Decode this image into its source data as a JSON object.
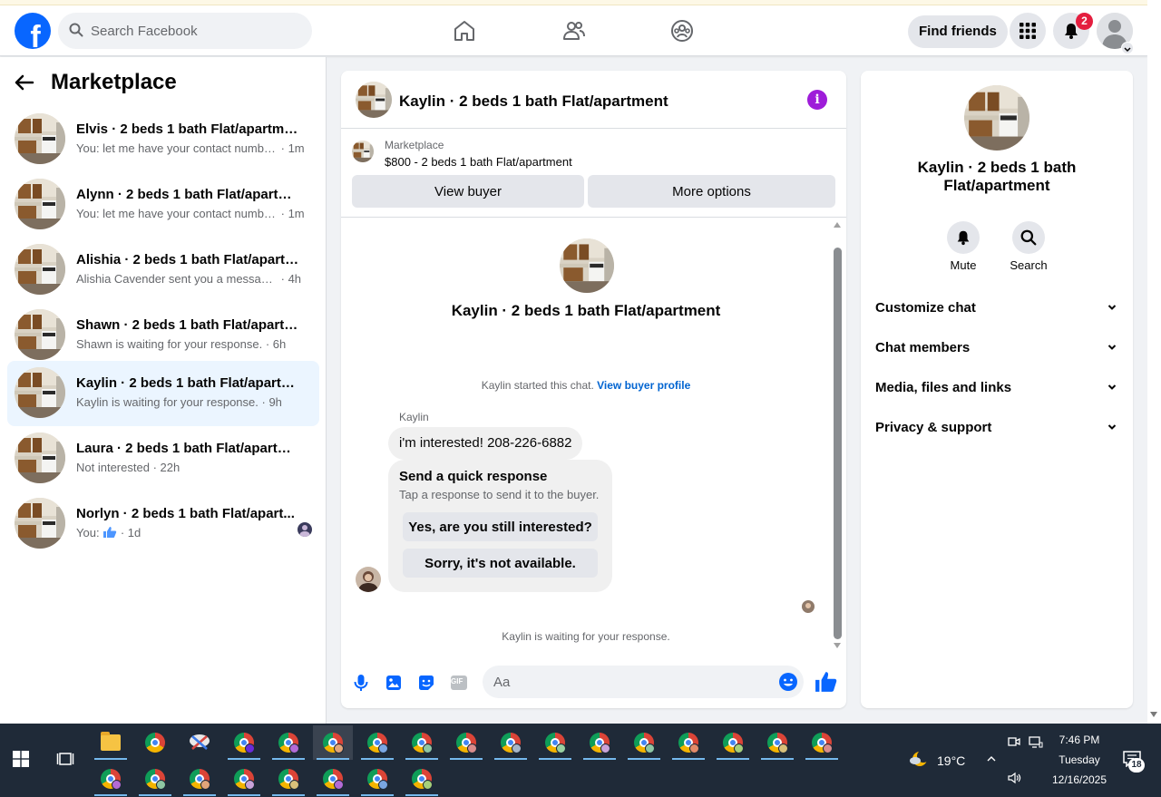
{
  "header": {
    "search_placeholder": "Search Facebook",
    "find_friends_label": "Find friends",
    "notification_count": "2"
  },
  "sidebar": {
    "title": "Marketplace",
    "conversations": [
      {
        "title": "Elvis · 2 beds 1 bath Flat/apartment",
        "message": "You: let me have your contact numbe...",
        "time": "· 1m"
      },
      {
        "title": "Alynn · 2 beds 1 bath Flat/apartment",
        "message": "You: let me have your contact numbe...",
        "time": "· 1m"
      },
      {
        "title": "Alishia · 2 beds 1 bath Flat/apartm...",
        "message": "Alishia Cavender sent you a message ...",
        "time": "· 4h"
      },
      {
        "title": "Shawn · 2 beds 1 bath Flat/apartm...",
        "message": "Shawn is waiting for your response.",
        "time": "· 6h"
      },
      {
        "title": "Kaylin · 2 beds 1 bath Flat/apartme...",
        "message": "Kaylin is waiting for your response.",
        "time": "· 9h"
      },
      {
        "title": "Laura · 2 beds 1 bath Flat/apartment",
        "message": "Not interested",
        "time": "· 22h"
      },
      {
        "title": "Norlyn · 2 beds 1 bath Flat/apart...",
        "message": "You:",
        "time": "· 1d"
      }
    ]
  },
  "chat": {
    "title": "Kaylin · 2 beds 1 bath Flat/apartment",
    "listing_category": "Marketplace",
    "listing_price": "$800 - 2 beds 1 bath Flat/apartment",
    "view_buyer_label": "View buyer",
    "more_options_label": "More options",
    "intro_title": "Kaylin · 2 beds 1 bath Flat/apartment",
    "started_text": "Kaylin started this chat.",
    "view_profile_link": "View buyer profile",
    "sender_name": "Kaylin",
    "message_text": "i'm interested! 208-226-6882",
    "quick_title": "Send a quick response",
    "quick_subtitle": "Tap a response to send it to the buyer.",
    "quick_reply_1": "Yes, are you still interested?",
    "quick_reply_2": "Sorry, it's not available.",
    "waiting_text": "Kaylin is waiting for your response.",
    "composer_placeholder": "Aa",
    "gif_label": "GIF"
  },
  "details": {
    "title": "Kaylin · 2 beds 1 bath Flat/apartment",
    "mute_label": "Mute",
    "search_label": "Search",
    "sections": [
      "Customize chat",
      "Chat members",
      "Media, files and links",
      "Privacy & support"
    ]
  },
  "taskbar": {
    "temperature": "19°C",
    "time": "7:46 PM",
    "day": "Tuesday",
    "date": "12/16/2025",
    "notification_count": "18"
  },
  "colors": {
    "brand_blue": "#0866ff",
    "link_blue": "#0064d1",
    "active_row": "#ebf5ff",
    "info_purple": "#9e1cd9",
    "badge_red": "#e41e3f",
    "taskbar_bg": "#1f2a38"
  }
}
